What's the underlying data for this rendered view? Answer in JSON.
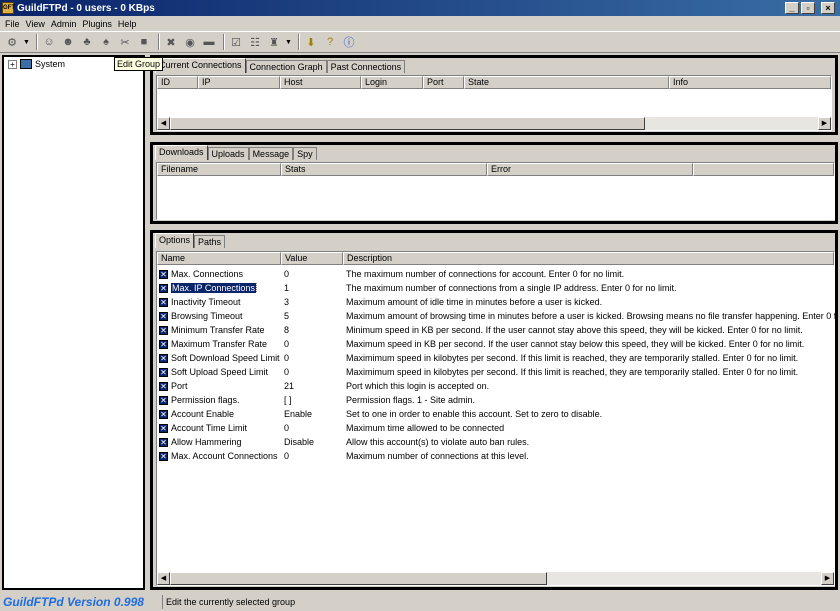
{
  "window": {
    "title": "GuildFTPd - 0 users - 0 KBps",
    "app_icon": "GFT"
  },
  "menu": [
    "File",
    "View",
    "Admin",
    "Plugins",
    "Help"
  ],
  "toolbar": {
    "icons": [
      "connect-icon",
      "dropdown-arrow",
      "user-add-icon",
      "user-edit-icon",
      "group-add-icon",
      "group-edit-icon",
      "disconnect-icon",
      "ban-icon",
      "kick-icon",
      "stop-icon",
      "log-icon",
      "settings-icon",
      "plugin-icon",
      "download-icon",
      "help-icon",
      "about-icon"
    ]
  },
  "tree": {
    "root_label": "System"
  },
  "tooltip": "Edit Group",
  "connections": {
    "tabs": [
      "Current Connections",
      "Connection Graph",
      "Past Connections"
    ],
    "columns": [
      "ID",
      "IP",
      "Host",
      "Login",
      "Port",
      "State",
      "Info"
    ]
  },
  "transfers": {
    "tabs": [
      "Downloads",
      "Uploads",
      "Message",
      "Spy"
    ],
    "columns": [
      "Filename",
      "Stats",
      "Error"
    ]
  },
  "options": {
    "tabs": [
      "Options",
      "Paths"
    ],
    "columns": [
      "Name",
      "Value",
      "Description"
    ],
    "rows": [
      {
        "name": "Max. Connections",
        "value": "0",
        "desc": "The maximum number of connections for account.  Enter 0 for no limit."
      },
      {
        "name": "Max. IP Connections",
        "value": "1",
        "desc": "The maximum number of connections from a single IP address.  Enter 0 for no limit."
      },
      {
        "name": "Inactivity Timeout",
        "value": "3",
        "desc": "Maximum amount of idle time in minutes before a user is kicked."
      },
      {
        "name": "Browsing Timeout",
        "value": "5",
        "desc": "Maximum amount of browsing time in minutes before a user is kicked.  Browsing means no file transfer happening.  Enter 0 f"
      },
      {
        "name": "Minimum Transfer Rate",
        "value": "8",
        "desc": "Minimum speed in KB per second.  If the user cannot stay above this speed, they will be kicked.  Enter 0 for no limit."
      },
      {
        "name": "Maximum Transfer Rate",
        "value": "0",
        "desc": "Maximum speed in KB per second.  If the user cannot stay below this speed, they will be kicked.  Enter 0 for no limit."
      },
      {
        "name": "Soft Download Speed Limit",
        "value": "0",
        "desc": "Maximimum speed in kilobytes per second.  If this limit is reached, they are temporarily stalled.  Enter 0 for no limit."
      },
      {
        "name": "Soft Upload Speed Limit",
        "value": "0",
        "desc": "Maximimum speed in kilobytes per second.  If this limit is reached, they are temporarily stalled.  Enter 0 for no limit."
      },
      {
        "name": "Port",
        "value": "21",
        "desc": "Port which this login is accepted on."
      },
      {
        "name": "Permission flags.",
        "value": "[ ]",
        "desc": "Permission flags. 1 - Site admin."
      },
      {
        "name": "Account Enable",
        "value": "Enable",
        "desc": "Set to one in order to enable this account.  Set to zero to disable."
      },
      {
        "name": "Account Time Limit",
        "value": "0",
        "desc": "Maximum time allowed to be connected"
      },
      {
        "name": "Allow Hammering",
        "value": "Disable",
        "desc": "Allow this account(s) to violate auto ban rules."
      },
      {
        "name": "Max. Account Connections",
        "value": "0",
        "desc": "Maximum number of connections at this level."
      }
    ],
    "selected_index": 1
  },
  "status": {
    "version": "GuildFTPd Version 0.998",
    "text": "Edit the currently selected group"
  }
}
